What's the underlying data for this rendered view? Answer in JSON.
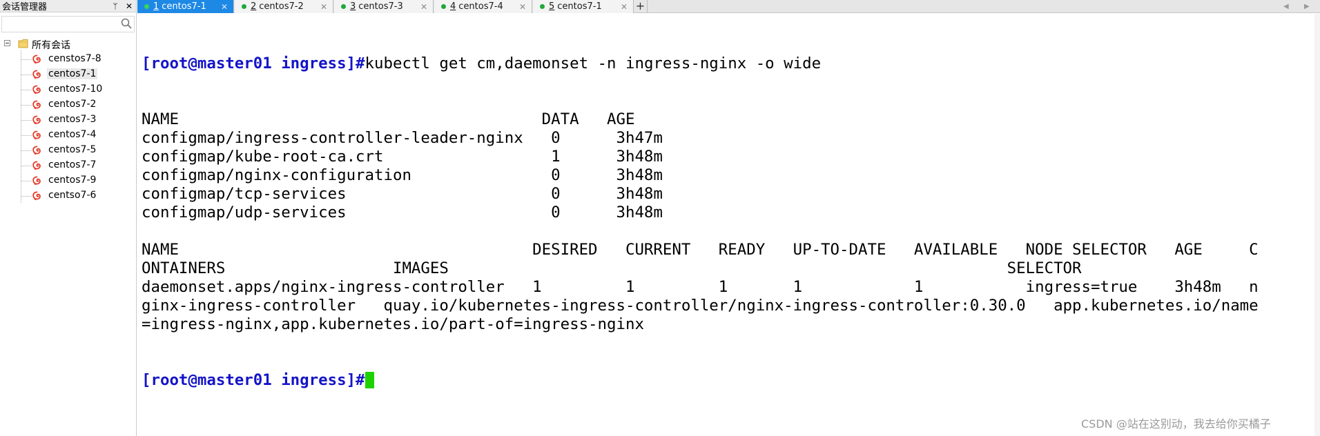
{
  "sidebar": {
    "title": "会话管理器",
    "pin_symbol": "ᛘ",
    "close_symbol": "✕",
    "search": {
      "placeholder": ""
    },
    "root_label": "所有会话",
    "sessions": [
      {
        "label": "censtos7-8"
      },
      {
        "label": "centos7-1"
      },
      {
        "label": "centos7-10"
      },
      {
        "label": "centos7-2"
      },
      {
        "label": "centos7-3"
      },
      {
        "label": "centos7-4"
      },
      {
        "label": "centos7-5"
      },
      {
        "label": "centos7-7"
      },
      {
        "label": "centos7-9"
      },
      {
        "label": "centso7-6"
      }
    ],
    "selected_index": 1
  },
  "tabs": [
    {
      "num": "1",
      "label": "centos7-1",
      "active": true
    },
    {
      "num": "2",
      "label": "centos7-2",
      "active": false
    },
    {
      "num": "3",
      "label": "centos7-3",
      "active": false
    },
    {
      "num": "4",
      "label": "centos7-4",
      "active": false
    },
    {
      "num": "5",
      "label": "centos7-1",
      "active": false
    }
  ],
  "tab_close": "✕",
  "tab_add": "+",
  "tab_nav": {
    "prev": "◀",
    "next": "▶"
  },
  "terminal": {
    "prompt": "[root@master01 ingress]#",
    "command": "kubectl get cm,daemonset -n ingress-nginx -o wide",
    "output_lines": [
      "NAME                                       DATA   AGE",
      "configmap/ingress-controller-leader-nginx   0      3h47m",
      "configmap/kube-root-ca.crt                  1      3h48m",
      "configmap/nginx-configuration               0      3h48m",
      "configmap/tcp-services                      0      3h48m",
      "configmap/udp-services                      0      3h48m",
      "",
      "NAME                                      DESIRED   CURRENT   READY   UP-TO-DATE   AVAILABLE   NODE SELECTOR   AGE     C",
      "ONTAINERS                  IMAGES                                                            SELECTOR",
      "daemonset.apps/nginx-ingress-controller   1         1         1       1            1           ingress=true    3h48m   n",
      "ginx-ingress-controller   quay.io/kubernetes-ingress-controller/nginx-ingress-controller:0.30.0   app.kubernetes.io/name",
      "=ingress-nginx,app.kubernetes.io/part-of=ingress-nginx"
    ],
    "final_prompt": "[root@master01 ingress]#"
  },
  "colors": {
    "active_tab": "#1e88e5",
    "prompt": "#1414c8",
    "cursor": "#1ed200",
    "session_icon": "#e23a2a"
  },
  "watermark": "CSDN @站在这别动，我去给你买橘子"
}
